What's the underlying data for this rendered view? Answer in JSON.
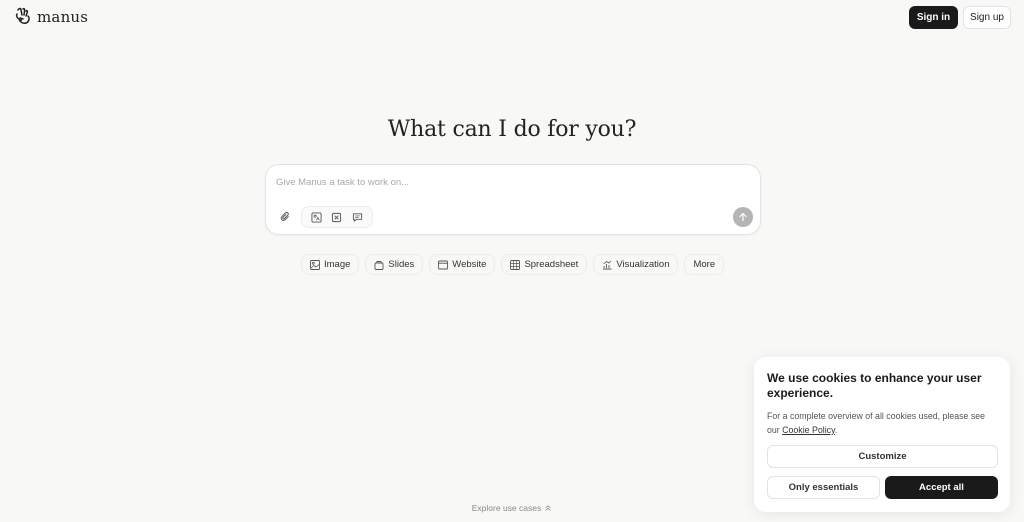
{
  "header": {
    "logo_text": "manus",
    "signin_label": "Sign in",
    "signup_label": "Sign up"
  },
  "main": {
    "heading": "What can I do for you?",
    "composer": {
      "placeholder": "Give Manus a task to work on...",
      "value": ""
    },
    "chips": [
      {
        "label": "Image",
        "icon": "image-icon"
      },
      {
        "label": "Slides",
        "icon": "slides-icon"
      },
      {
        "label": "Website",
        "icon": "website-icon"
      },
      {
        "label": "Spreadsheet",
        "icon": "spreadsheet-icon"
      },
      {
        "label": "Visualization",
        "icon": "visualization-icon"
      },
      {
        "label": "More",
        "icon": ""
      }
    ],
    "explore_label": "Explore use cases"
  },
  "cookie": {
    "title": "We use cookies to enhance your user experience.",
    "desc_before": "For a complete overview of all cookies used, please see our ",
    "link_label": "Cookie Policy",
    "desc_after": ".",
    "customize_label": "Customize",
    "essentials_label": "Only essentials",
    "accept_label": "Accept all"
  },
  "colors": {
    "background": "#f8f8f7",
    "primary_button": "#1a1a1a",
    "send_button": "#b5b5b5"
  }
}
